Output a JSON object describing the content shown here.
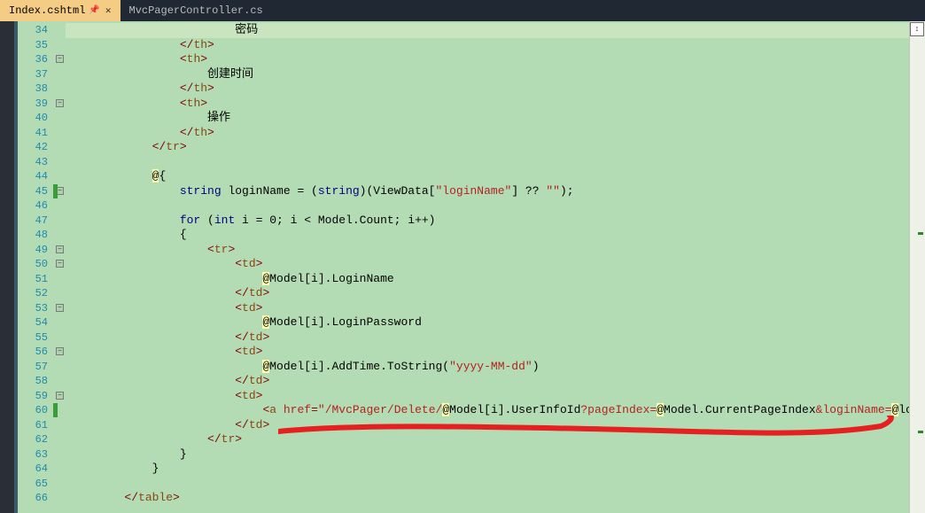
{
  "tabs": {
    "active": "Index.cshtml",
    "inactive": "MvcPagerController.cs"
  },
  "lines": [
    {
      "num": "34",
      "indent": 24,
      "html": "<span class='c-plain'>密码</span>",
      "active": true
    },
    {
      "num": "35",
      "indent": 16,
      "html": "<span class='c-tag'>&lt;/</span><span class='c-punc'>th</span><span class='c-tag'>&gt;</span>"
    },
    {
      "num": "36",
      "indent": 16,
      "html": "<span class='c-tag'>&lt;</span><span class='c-punc'>th</span><span class='c-tag'>&gt;</span>"
    },
    {
      "num": "37",
      "indent": 20,
      "html": "<span class='c-plain'>创建时间</span>"
    },
    {
      "num": "38",
      "indent": 16,
      "html": "<span class='c-tag'>&lt;/</span><span class='c-punc'>th</span><span class='c-tag'>&gt;</span>"
    },
    {
      "num": "39",
      "indent": 16,
      "html": "<span class='c-tag'>&lt;</span><span class='c-punc'>th</span><span class='c-tag'>&gt;</span>"
    },
    {
      "num": "40",
      "indent": 20,
      "html": "<span class='c-plain'>操作</span>"
    },
    {
      "num": "41",
      "indent": 16,
      "html": "<span class='c-tag'>&lt;/</span><span class='c-punc'>th</span><span class='c-tag'>&gt;</span>"
    },
    {
      "num": "42",
      "indent": 12,
      "html": "<span class='c-tag'>&lt;/</span><span class='c-punc'>tr</span><span class='c-tag'>&gt;</span>"
    },
    {
      "num": "43",
      "indent": 0,
      "html": ""
    },
    {
      "num": "44",
      "indent": 12,
      "html": "<span class='c-rz'>@</span><span class='c-plain'>{</span>"
    },
    {
      "num": "45",
      "indent": 16,
      "html": "<span class='c-kw'>string</span><span class='c-plain'> loginName = (</span><span class='c-kw'>string</span><span class='c-plain'>)(ViewData[</span><span class='c-str'>\"loginName\"</span><span class='c-plain'>] ?? </span><span class='c-str'>\"\"</span><span class='c-plain'>);</span>",
      "mark": true
    },
    {
      "num": "46",
      "indent": 0,
      "html": ""
    },
    {
      "num": "47",
      "indent": 16,
      "html": "<span class='c-kw'>for</span><span class='c-plain'> (</span><span class='c-kw'>int</span><span class='c-plain'> i = 0; i &lt; Model.Count; i++)</span>"
    },
    {
      "num": "48",
      "indent": 16,
      "html": "<span class='c-plain'>{</span>"
    },
    {
      "num": "49",
      "indent": 20,
      "html": "<span class='c-tag'>&lt;</span><span class='c-punc'>tr</span><span class='c-tag'>&gt;</span>"
    },
    {
      "num": "50",
      "indent": 24,
      "html": "<span class='c-tag'>&lt;</span><span class='c-punc'>td</span><span class='c-tag'>&gt;</span>"
    },
    {
      "num": "51",
      "indent": 28,
      "html": "<span class='c-rz'>@</span><span class='c-plain'>Model[i].LoginName</span>"
    },
    {
      "num": "52",
      "indent": 24,
      "html": "<span class='c-tag'>&lt;/</span><span class='c-punc'>td</span><span class='c-tag'>&gt;</span>"
    },
    {
      "num": "53",
      "indent": 24,
      "html": "<span class='c-tag'>&lt;</span><span class='c-punc'>td</span><span class='c-tag'>&gt;</span>"
    },
    {
      "num": "54",
      "indent": 28,
      "html": "<span class='c-rz'>@</span><span class='c-plain'>Model[i].LoginPassword</span>"
    },
    {
      "num": "55",
      "indent": 24,
      "html": "<span class='c-tag'>&lt;/</span><span class='c-punc'>td</span><span class='c-tag'>&gt;</span>"
    },
    {
      "num": "56",
      "indent": 24,
      "html": "<span class='c-tag'>&lt;</span><span class='c-punc'>td</span><span class='c-tag'>&gt;</span>"
    },
    {
      "num": "57",
      "indent": 28,
      "html": "<span class='c-rz'>@</span><span class='c-plain'>Model[i].AddTime.ToString(</span><span class='c-str'>\"yyyy-MM-dd\"</span><span class='c-plain'>)</span>"
    },
    {
      "num": "58",
      "indent": 24,
      "html": "<span class='c-tag'>&lt;/</span><span class='c-punc'>td</span><span class='c-tag'>&gt;</span>"
    },
    {
      "num": "59",
      "indent": 24,
      "html": "<span class='c-tag'>&lt;</span><span class='c-punc'>td</span><span class='c-tag'>&gt;</span>"
    },
    {
      "num": "60",
      "indent": 28,
      "html": "<span class='c-tag'>&lt;</span><span class='c-punc'>a</span><span class='c-attr'> href</span><span class='c-tag'>=</span><span class='c-str'>\"/MvcPager/Delete/</span><span class='c-rz'>@</span><span class='c-plain'>Model[i].UserInfoId</span><span class='c-str'>?pageIndex=</span><span class='c-rz'>@</span><span class='c-plain'>Model.CurrentPageIndex</span><span class='c-str'>&amp;loginName=</span><span class='c-rz'>@</span><span class='c-plain'>loginName</span><span class='c-str'>\"</span><span class='c-tag'>&gt;</span><span class='c-plain'>删除</span><span class='c-tag'>&lt;/</span><span class='c-punc'>a</span><span class='c-tag'>&gt;</span>",
      "mark": true
    },
    {
      "num": "61",
      "indent": 24,
      "html": "<span class='c-tag'>&lt;/</span><span class='c-punc'>td</span><span class='c-tag'>&gt;</span>"
    },
    {
      "num": "62",
      "indent": 20,
      "html": "<span class='c-tag'>&lt;/</span><span class='c-punc'>tr</span><span class='c-tag'>&gt;</span>"
    },
    {
      "num": "63",
      "indent": 16,
      "html": "<span class='c-plain'>}</span>"
    },
    {
      "num": "64",
      "indent": 12,
      "html": "<span class='c-plain'>}</span>"
    },
    {
      "num": "65",
      "indent": 0,
      "html": ""
    },
    {
      "num": "66",
      "indent": 8,
      "html": "<span class='c-tag'>&lt;/</span><span class='c-punc'>table</span><span class='c-tag'>&gt;</span>"
    }
  ],
  "outline_boxes": [
    36,
    39,
    45,
    49,
    50,
    53,
    56,
    59
  ],
  "scroll_marks": [
    238,
    462
  ]
}
